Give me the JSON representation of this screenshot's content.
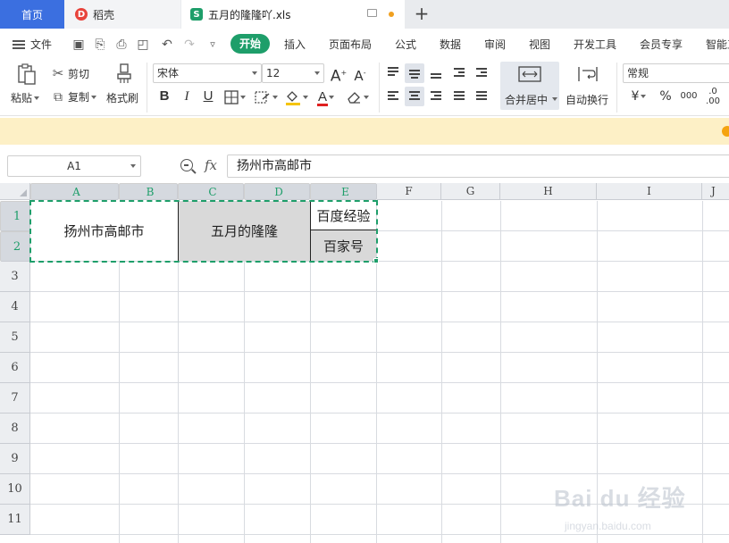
{
  "tabs": {
    "home": "首页",
    "daoke": "稻壳",
    "file": "五月的隆隆吖.xls",
    "file_icon": "S",
    "daoke_icon": "D"
  },
  "menu": {
    "file_label": "文件",
    "items": [
      "开始",
      "插入",
      "页面布局",
      "公式",
      "数据",
      "审阅",
      "视图",
      "开发工具",
      "会员专享",
      "智能工具箱"
    ]
  },
  "ribbon": {
    "paste": "粘贴",
    "cut": "剪切",
    "copy": "复制",
    "format_painter": "格式刷",
    "font_name": "宋体",
    "font_size": "12",
    "bold": "B",
    "italic": "I",
    "underline": "U",
    "font_color_letter": "A",
    "grow_font": "A",
    "shrink_font": "A",
    "merge_center": "合并居中",
    "wrap_text": "自动换行",
    "number_format": "常规",
    "currency": "¥",
    "percent": "%",
    "thousands": "000",
    "inc_decimal": ".00",
    "dec_decimal": ".0"
  },
  "formula": {
    "name_box": "A1",
    "fx": "fx",
    "content": "扬州市高邮市"
  },
  "sheet": {
    "columns": [
      "A",
      "B",
      "C",
      "D",
      "E",
      "F",
      "G",
      "H",
      "I",
      "J"
    ],
    "rows": [
      "1",
      "2",
      "3",
      "4",
      "5",
      "6",
      "7",
      "8",
      "9",
      "10",
      "11"
    ],
    "cells": {
      "a1": "扬州市高邮市",
      "c1": "五月的隆隆",
      "e1": "百度经验",
      "e2": "百家号"
    }
  },
  "watermark": {
    "logo": "Bai du 经验",
    "url": "jingyan.baidu.com"
  },
  "colors": {
    "accent": "#1e9e6a",
    "tab_active": "#3b6fe0",
    "notice": "#fdf0c6",
    "gray_fill": "#d9d9d9"
  }
}
